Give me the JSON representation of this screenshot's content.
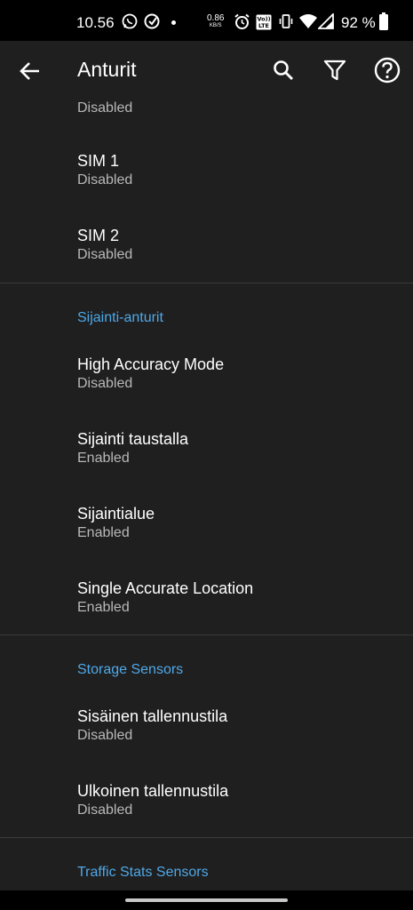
{
  "status_bar": {
    "time": "10.56",
    "net_speed_value": "0.86",
    "net_speed_unit": "KB/S",
    "volte_label_top": "Vo))",
    "volte_label_bottom": "LTE",
    "battery_percent": "92 %",
    "icons": [
      "whatsapp-icon",
      "sync-app-icon",
      "notification-dot",
      "alarm-icon",
      "volte-icon",
      "vibrate-icon",
      "wifi-icon",
      "signal-icon",
      "battery-icon"
    ]
  },
  "app_bar": {
    "title": "Anturit",
    "actions": [
      "search-icon",
      "filter-icon",
      "help-icon"
    ]
  },
  "list": {
    "partial_item": {
      "subtitle": "Disabled"
    },
    "sim1": {
      "title": "SIM 1",
      "subtitle": "Disabled"
    },
    "sim2": {
      "title": "SIM 2",
      "subtitle": "Disabled"
    },
    "location_section": {
      "header": "Sijainti-anturit",
      "items": [
        {
          "title": "High Accuracy Mode",
          "subtitle": "Disabled"
        },
        {
          "title": "Sijainti taustalla",
          "subtitle": "Enabled"
        },
        {
          "title": "Sijaintialue",
          "subtitle": "Enabled"
        },
        {
          "title": "Single Accurate Location",
          "subtitle": "Enabled"
        }
      ]
    },
    "storage_section": {
      "header": "Storage Sensors",
      "items": [
        {
          "title": "Sisäinen tallennustila",
          "subtitle": "Disabled"
        },
        {
          "title": "Ulkoinen tallennustila",
          "subtitle": "Disabled"
        }
      ]
    },
    "traffic_section": {
      "header": "Traffic Stats Sensors"
    }
  },
  "colors": {
    "background": "#1f1f1f",
    "accent": "#4fa8e8",
    "secondary_text": "#b8b8b8",
    "divider": "#3a3a3a"
  }
}
